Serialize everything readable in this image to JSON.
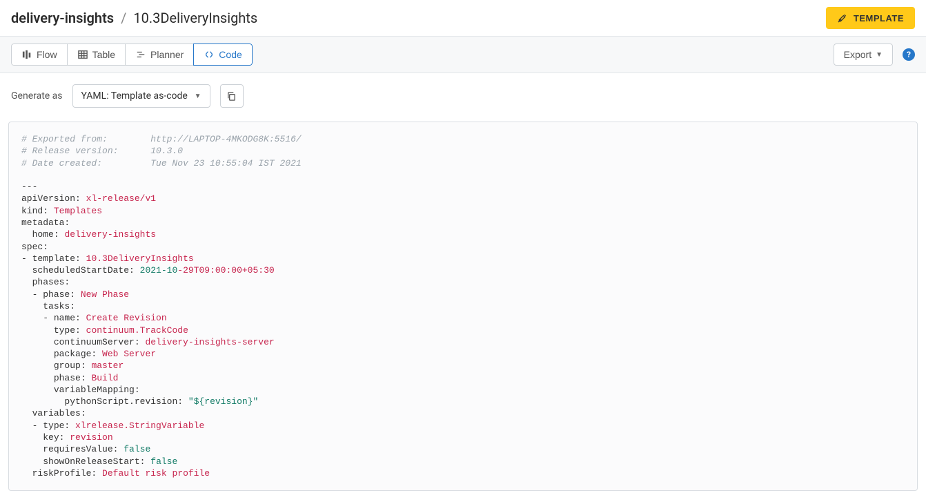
{
  "breadcrumb": {
    "folder": "delivery-insights",
    "sep": "/",
    "name": "10.3DeliveryInsights"
  },
  "template_button": "TEMPLATE",
  "tabs": {
    "flow": "Flow",
    "table": "Table",
    "planner": "Planner",
    "code": "Code"
  },
  "export": "Export",
  "generate": {
    "label": "Generate as",
    "value": "YAML: Template as-code"
  },
  "code": {
    "c1": "# Exported from:        http://LAPTOP-4MKODG8K:5516/",
    "c2": "# Release version:      10.3.0",
    "c3": "# Date created:         Tue Nov 23 10:55:04 IST 2021",
    "dashes": "---",
    "apiVersion_k": "apiVersion:",
    "apiVersion_v": "xl-release/v1",
    "kind_k": "kind:",
    "kind_v": "Templates",
    "metadata_k": "metadata:",
    "home_k": "home:",
    "home_v": "delivery-insights",
    "spec_k": "spec:",
    "template_k": "- template:",
    "template_v": "10.3DeliveryInsights",
    "ssd_k": "scheduledStartDate:",
    "ssd_v1": "2021-10",
    "ssd_v2": "-29T09:00:00+05:30",
    "phases_k": "phases:",
    "phase_k": "- phase:",
    "phase_v": "New Phase",
    "tasks_k": "tasks:",
    "name_k": "- name:",
    "name_v": "Create Revision",
    "type_k": "type:",
    "type_v": "continuum.TrackCode",
    "cs_k": "continuumServer:",
    "cs_v": "delivery-insights-server",
    "pkg_k": "package:",
    "pkg_v": "Web Server",
    "group_k": "group:",
    "group_v": "master",
    "bphase_k": "phase:",
    "bphase_v": "Build",
    "vm_k": "variableMapping:",
    "psr_k": "pythonScript.revision:",
    "psr_v": "\"${revision}\"",
    "vars_k": "variables:",
    "vtype_k": "- type:",
    "vtype_v": "xlrelease.StringVariable",
    "vkey_k": "key:",
    "vkey_v": "revision",
    "rv_k": "requiresValue:",
    "rv_v": "false",
    "sors_k": "showOnReleaseStart:",
    "sors_v": "false",
    "rp_k": "riskProfile:",
    "rp_v": "Default risk profile"
  }
}
